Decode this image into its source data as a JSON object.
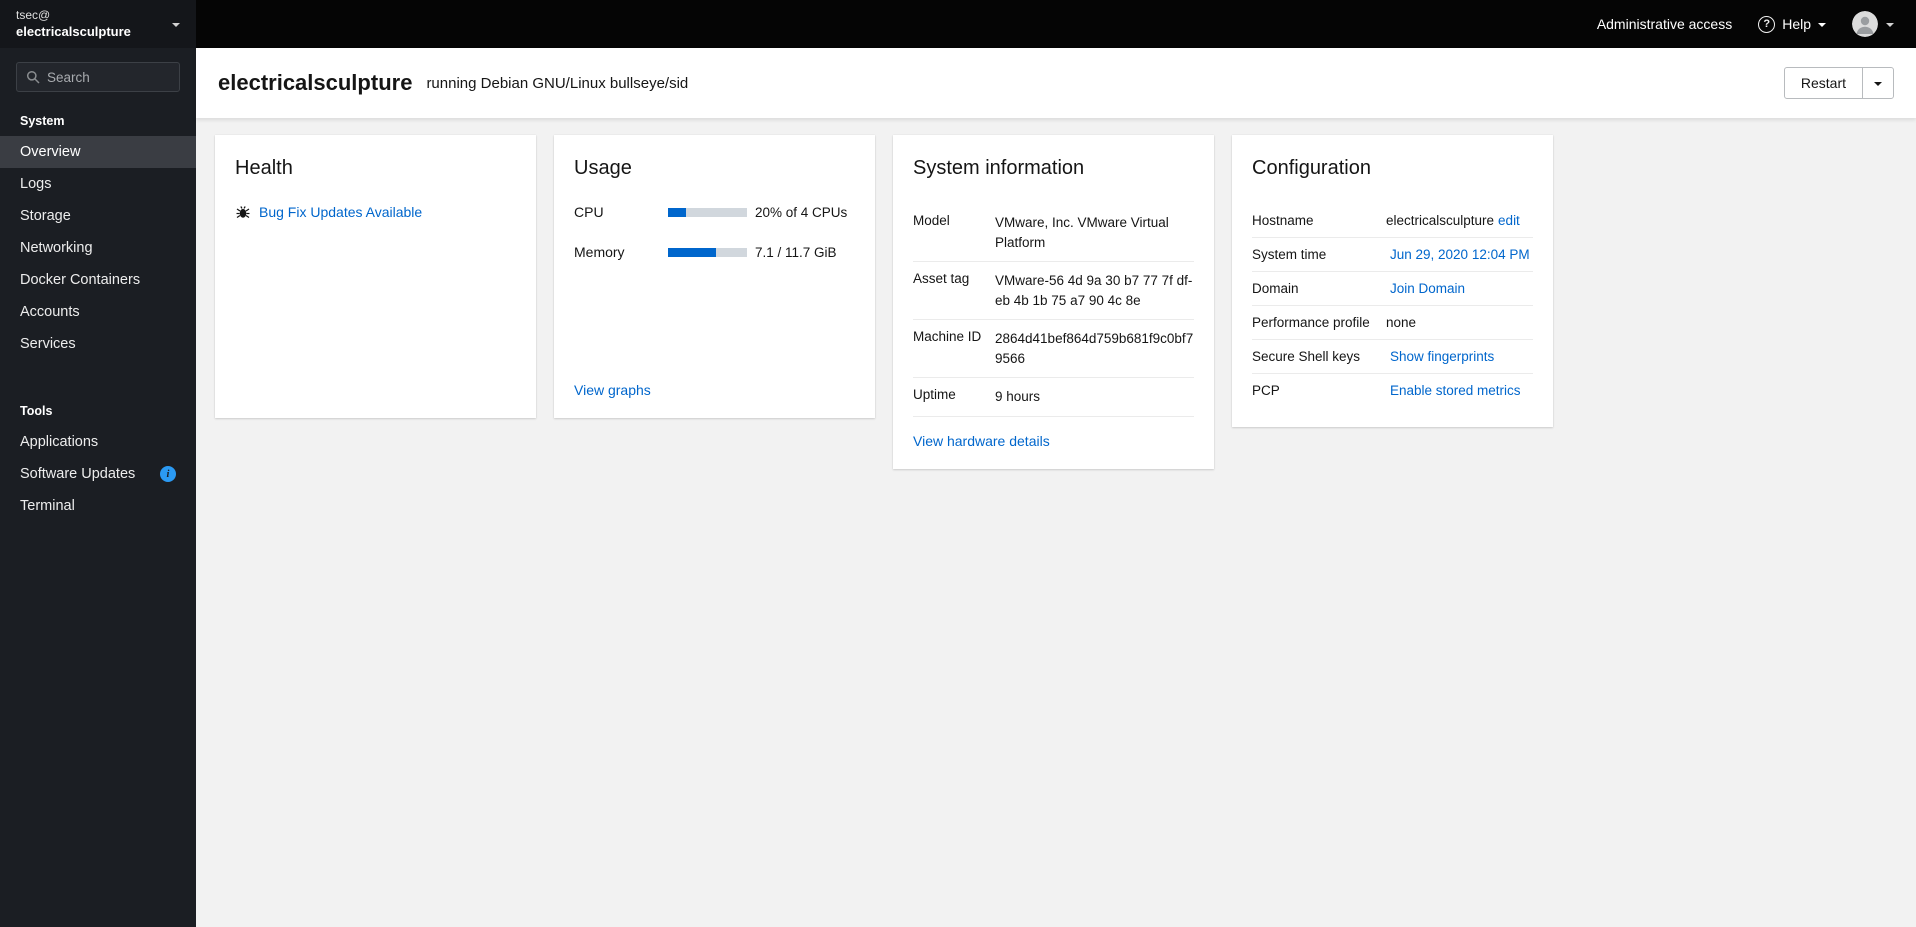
{
  "topbar": {
    "admin_access_label": "Administrative access",
    "help_label": "Help"
  },
  "sidebar": {
    "user": "tsec@",
    "host": "electricalsculpture",
    "search_placeholder": "Search",
    "active_item": "Overview",
    "sections": [
      {
        "label": "System",
        "items": [
          "Overview",
          "Logs",
          "Storage",
          "Networking",
          "Docker Containers",
          "Accounts",
          "Services"
        ]
      },
      {
        "label": "Tools",
        "items": [
          "Applications",
          "Software Updates",
          "Terminal"
        ]
      }
    ],
    "software_updates_badge": "i"
  },
  "header": {
    "hostname": "electricalsculpture",
    "os_text": "running Debian GNU/Linux bullseye/sid",
    "restart_label": "Restart"
  },
  "health": {
    "title": "Health",
    "updates_link": "Bug Fix Updates Available"
  },
  "usage": {
    "title": "Usage",
    "cpu_label": "CPU",
    "cpu_value": "20% of 4 CPUs",
    "cpu_percent": 23,
    "memory_label": "Memory",
    "memory_value": "7.1 / 11.7 GiB",
    "memory_percent": 61,
    "view_graphs_label": "View graphs"
  },
  "system_information": {
    "title": "System information",
    "rows": [
      {
        "label": "Model",
        "value": "VMware, Inc. VMware Virtual Platform"
      },
      {
        "label": "Asset tag",
        "value": "VMware-56 4d 9a 30 b7 77 7f df-eb 4b 1b 75 a7 90 4c 8e"
      },
      {
        "label": "Machine ID",
        "value": "2864d41bef864d759b681f9c0bf79566"
      },
      {
        "label": "Uptime",
        "value": "9 hours"
      }
    ],
    "hardware_link": "View hardware details"
  },
  "configuration": {
    "title": "Configuration",
    "rows": [
      {
        "label": "Hostname",
        "value": "electricalsculpture",
        "link": "edit"
      },
      {
        "label": "System time",
        "value": "",
        "link": "Jun 29, 2020 12:04 PM"
      },
      {
        "label": "Domain",
        "value": "",
        "link": "Join Domain"
      },
      {
        "label": "Performance profile",
        "value": "none",
        "link": ""
      },
      {
        "label": "Secure Shell keys",
        "value": "",
        "link": "Show fingerprints"
      },
      {
        "label": "PCP",
        "value": "",
        "link": "Enable stored metrics"
      }
    ]
  },
  "colors": {
    "accent_blue": "#0066cc",
    "progress_track": "#d1d7dd",
    "info_badge": "#2b9af3",
    "sidebar_bg": "#1b1e23",
    "topbar_bg": "#050505"
  }
}
